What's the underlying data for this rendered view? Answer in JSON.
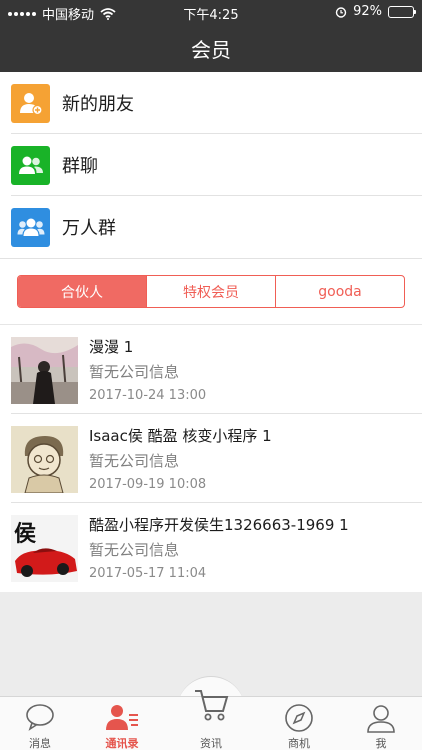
{
  "status": {
    "carrier": "中国移动",
    "time": "下午4:25",
    "battery": "92%",
    "battery_level": 0.92
  },
  "header": {
    "title": "会员"
  },
  "menu": [
    {
      "label": "新的朋友",
      "icon": "add-friend-icon",
      "color": "#f5a234"
    },
    {
      "label": "群聊",
      "icon": "group-chat-icon",
      "color": "#19b328"
    },
    {
      "label": "万人群",
      "icon": "large-group-icon",
      "color": "#2f8ee0"
    }
  ],
  "tabs": [
    "合伙人",
    "特权会员",
    "gooda"
  ],
  "members": [
    {
      "name": "漫漫  1",
      "company": "暂无公司信息",
      "date": "2017-10-24 13:00"
    },
    {
      "name": "Isaac侯 酷盈 核变小程序  1",
      "company": "暂无公司信息",
      "date": "2017-09-19 10:08"
    },
    {
      "name": "酷盈小程序开发侯生1326663-1969  1",
      "company": "暂无公司信息",
      "date": "2017-05-17 11:04"
    }
  ],
  "avatar_text": "侯",
  "tabbar": [
    {
      "label": "消息",
      "icon": "chat-bubble-icon"
    },
    {
      "label": "通讯录",
      "icon": "contacts-icon",
      "active": true
    },
    {
      "label": "资讯",
      "icon": "cart-icon"
    },
    {
      "label": "商机",
      "icon": "compass-icon"
    },
    {
      "label": "我",
      "icon": "person-icon"
    }
  ],
  "colors": {
    "accent": "#f05e55",
    "header_bg": "#363636"
  }
}
